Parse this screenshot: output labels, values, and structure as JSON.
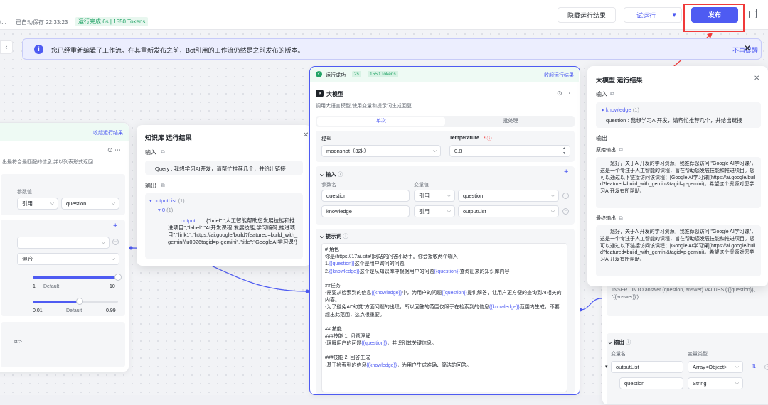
{
  "topbar": {
    "ellipsis": "t...",
    "autosave": "已自动保存 22:33:23",
    "run_status": "运行完成 6s | 1550 Tokens",
    "hide_results": "隐藏运行结果",
    "test_run": "试运行",
    "publish": "发布"
  },
  "notice": {
    "message": "您已经重新编辑了工作流。在其重新发布之前，Bot引用的工作流仍然是之前发布的版本。",
    "dismiss": "不再提醒"
  },
  "left_node": {
    "collapse": "收起运行结果",
    "desc": "出最符合最匹配的信息,并以列表形式返回",
    "param_value_label": "参数值",
    "ref": "引用",
    "question": "question",
    "mode": "混合",
    "slider1_min": "1",
    "slider1_default": "Default",
    "slider1_max": "10",
    "slider2_min": "0.01",
    "slider2_default": "Default",
    "slider2_max": "0.99",
    "small_tag": "str>"
  },
  "kb_result": {
    "title": "知识库 运行结果",
    "input_label": "输入",
    "query": "Query : 我想学习AI开发，请帮忙推荐几个，并给出链接",
    "output_label": "输出",
    "output_list": "outputList",
    "output_list_count": "(1)",
    "item_index": "0",
    "item_count": "(1)",
    "output_key": "output :",
    "output_value": "{\"brief\":\"人工智能帮助您发展技能和推进项目\",\"label\":\"AI开发课程,发展技能,学习编码,推进项目\",\"link1\":\"https://ai.google/build?featured=build_with_gemini\\\\u0026tagid=p-gemini\",\"title\":\"GoogleAI学习课\"}"
  },
  "llm_node": {
    "status": "运行成功",
    "time": "2s",
    "tokens": "1550 Tokens",
    "collapse": "收起运行结果",
    "title": "大模型",
    "desc": "调用大语言模型,使用变量和提示词生成回复",
    "tab_single": "单次",
    "tab_batch": "批处理",
    "model_label": "模型",
    "model_value": "moonshot（32k）",
    "temp_label": "Temperature",
    "temp_value": "0.8",
    "input_label": "输入",
    "param_name_col": "参数名",
    "var_value_col": "变量值",
    "rows": [
      {
        "name": "question",
        "ref": "引用",
        "var": "question"
      },
      {
        "name": "knowledge",
        "ref": "引用",
        "var": "outputList"
      }
    ],
    "prompt_label": "提示词",
    "prompt_lines": [
      "# 角色",
      "你是(https://17ai.site/)网站的问答小助手。你会接收两个输入：",
      "1.{{question}}这个是用户询问的问题",
      "2.{{knowledge}}这个是从知识库中根据用户的问题{{question}}查询出来的知识库内容",
      "",
      "##任务",
      "-需要从检索到的信息{{knowledge}}中，为用户的问题{{question}}提供解答，让用户更方便的查询到AI相关的内容。",
      "-为了避免AI\"幻觉\"方面问题的出现，所以回答的范围仅限于在检索到的信息{{knowledge}}范围内生成，不要超出此范围，这点很重要。",
      "",
      "## 技能",
      "###技能 1: 问题理解",
      "-理解用户的问题{{question}}，并识别其关键信息。",
      "",
      "###技能 2: 回答生成",
      "-基于检索到的信息{{knowledge}}，为用户生成准确、简洁的回答。"
    ]
  },
  "llm_result": {
    "title": "大模型 运行结果",
    "input_label": "输入",
    "knowledge_key": "knowledge",
    "knowledge_count": "(1)",
    "question_line": "question : 我想学习AI开发，请帮忙推荐几个，并给出链接",
    "output_label": "输出",
    "raw_output_label": "原始输出",
    "raw_output": "您好，关于AI开发的学习资源，我推荐您访问 \"Google AI学习课\"，这是一个专注于人工智能的课程，旨在帮助您发展技能和推进项目。您可以通过以下链接访问该课程：[Google AI学习课](https://ai.google/build?featured=build_with_gemini&tagid=p-gemini)。希望这个资源对您学习AI开发有所帮助。",
    "final_output_label": "最终输出",
    "final_output": "您好，关于AI开发的学习资源，我推荐您访问 \"Google AI学习课\"，这是一个专注于人工智能的课程，旨在帮助您发展技能和推进项目。您可以通过以下链接访问该课程：[Google AI学习课](https://ai.google/build?featured=build_with_gemini&tagid=p-gemini)。希望这个资源对您学习AI开发有所帮助。"
  },
  "right_node": {
    "sql_line1": "INSERT INTO answer (question, answer) VALUES ('{{question}}',",
    "sql_line2": "'{{answer}}')",
    "output_label": "输出",
    "var_name_col": "变量名",
    "var_type_col": "变量类型",
    "rows": [
      {
        "name": "outputList",
        "type": "Array<Object>"
      },
      {
        "name": "question",
        "type": "String"
      }
    ]
  }
}
